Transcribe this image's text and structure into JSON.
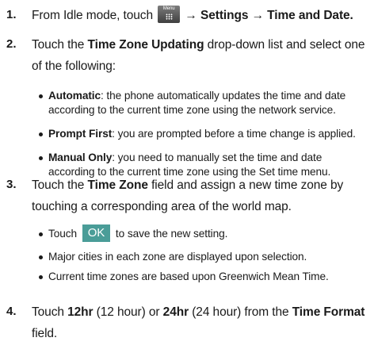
{
  "steps": [
    {
      "number": "1.",
      "lead": "From Idle mode, touch",
      "menu_icon_label": "Menu",
      "path": "→ Settings → Time and Date."
    },
    {
      "number": "2.",
      "touch": "Touch the",
      "field": "Time Zone Updating",
      "rest": "drop-down list and select one of the following:",
      "options": [
        {
          "name": "Automatic",
          "desc": ": the phone automatically updates the time and date according to the current time zone using the network service."
        },
        {
          "name": "Prompt First",
          "desc": ": you are prompted before a time change is applied."
        },
        {
          "name": "Manual Only",
          "desc": ": you need to manually set the time and date according to the current time zone using the Set time menu."
        }
      ]
    },
    {
      "number": "3.",
      "touch": "Touch the",
      "field": "Time Zone",
      "rest": "field and assign a new time zone by touching a corresponding area of the world map.",
      "bullet1_pre": "Touch",
      "ok_label": "OK",
      "bullet1_post": "to save the new setting.",
      "bullet2": "Major cities in each zone are displayed upon selection.",
      "bullet3": "Current time zones are based upon Greenwich Mean Time."
    },
    {
      "number": "4.",
      "touch": "Touch",
      "opt12": "12hr",
      "opt12_desc": "(12 hour) or",
      "opt24": "24hr",
      "opt24_desc": "(24 hour) from the",
      "field": "Time Format",
      "rest": "field."
    }
  ]
}
